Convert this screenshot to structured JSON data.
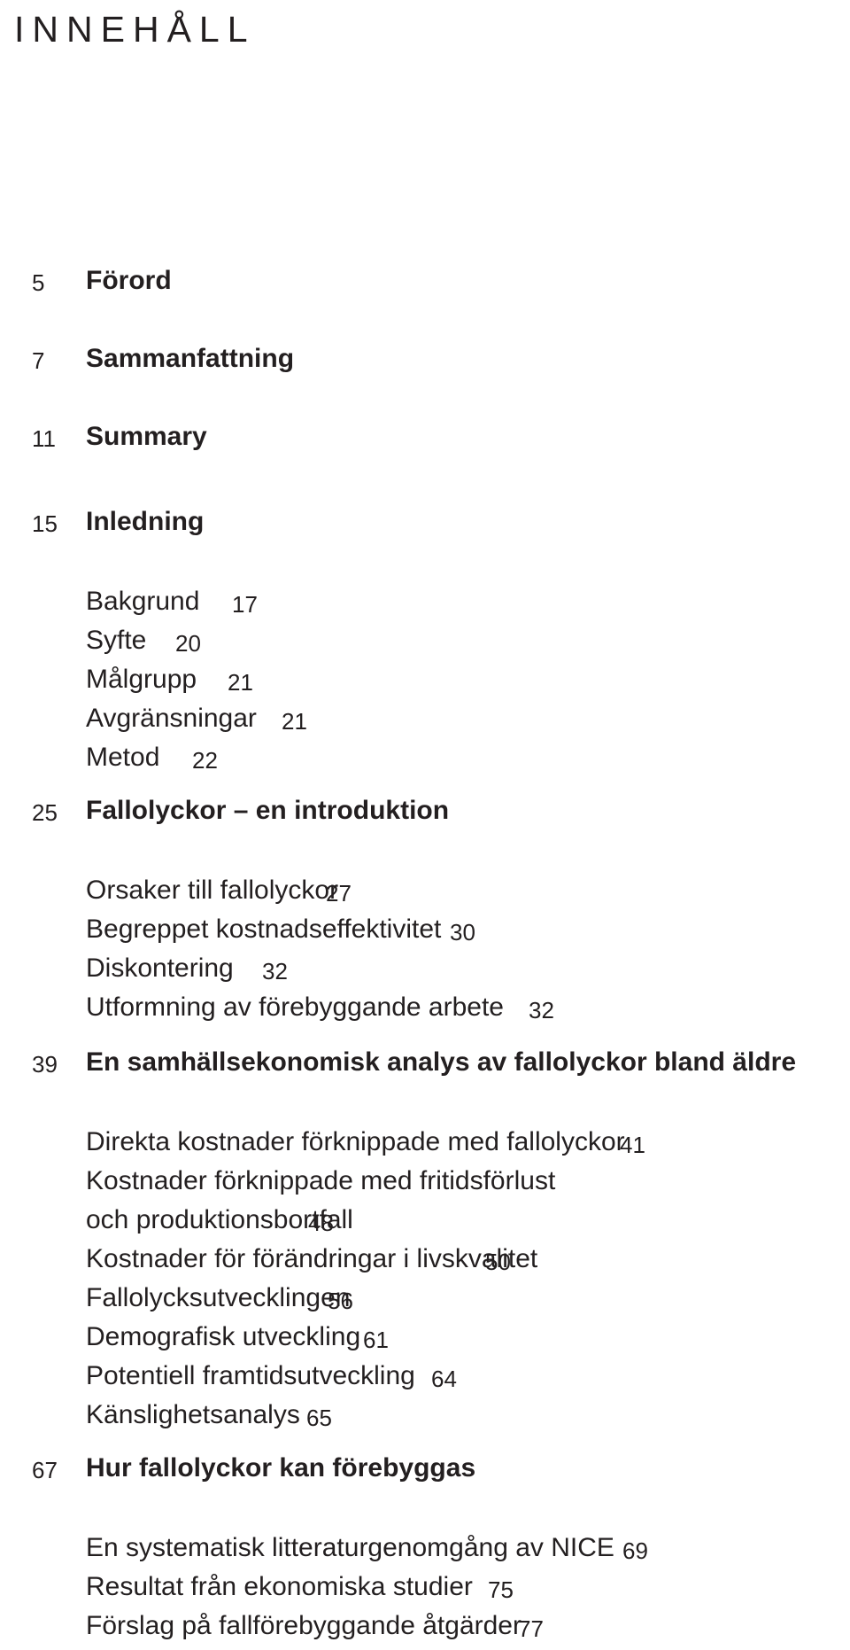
{
  "document": {
    "heading": "INNEHÅLL",
    "sections": [
      {
        "page": "5",
        "title": "Förord",
        "children": []
      },
      {
        "page": "7",
        "title": "Sammanfattning",
        "children": []
      },
      {
        "page": "11",
        "title": "Summary",
        "children": []
      },
      {
        "page": "15",
        "title": "Inledning",
        "children": [
          {
            "label": "Bakgrund",
            "page": "17"
          },
          {
            "label": "Syfte",
            "page": "20"
          },
          {
            "label": "Målgrupp",
            "page": "21"
          },
          {
            "label": "Avgränsningar",
            "page": "21"
          },
          {
            "label": "Metod",
            "page": "22"
          }
        ]
      },
      {
        "page": "25",
        "title": "Fallolyckor – en introduktion",
        "children": [
          {
            "label": "Orsaker till fallolyckor",
            "page": "27"
          },
          {
            "label": "Begreppet kostnadseffektivitet",
            "page": "30"
          },
          {
            "label": "Diskontering",
            "page": "32"
          },
          {
            "label": "Utformning av förebyggande arbete",
            "page": "32"
          }
        ]
      },
      {
        "page": "39",
        "title": "En samhällsekonomisk analys av fallolyckor bland äldre",
        "children": [
          {
            "label": "Direkta kostnader förknippade med fallolyckor",
            "page": "41"
          },
          {
            "label": "Kostnader förknippade med fritidsförlust",
            "page": ""
          },
          {
            "label": "och produktionsbortfall",
            "page": "48"
          },
          {
            "label": "Kostnader för förändringar i livskvalitet",
            "page": "50"
          },
          {
            "label": "Fallolycksutvecklingen",
            "page": "56"
          },
          {
            "label": "Demografisk utveckling",
            "page": "61"
          },
          {
            "label": "Potentiell framtidsutveckling",
            "page": "64"
          },
          {
            "label": "Känslighetsanalys",
            "page": "65"
          }
        ]
      },
      {
        "page": "67",
        "title": "Hur fallolyckor kan förebyggas",
        "children": [
          {
            "label": "En systematisk litteraturgenomgång av NICE",
            "page": "69"
          },
          {
            "label": "Resultat från ekonomiska studier",
            "page": "75"
          },
          {
            "label": "Förslag på fallförebyggande åtgärder",
            "page": "77"
          }
        ]
      }
    ]
  }
}
